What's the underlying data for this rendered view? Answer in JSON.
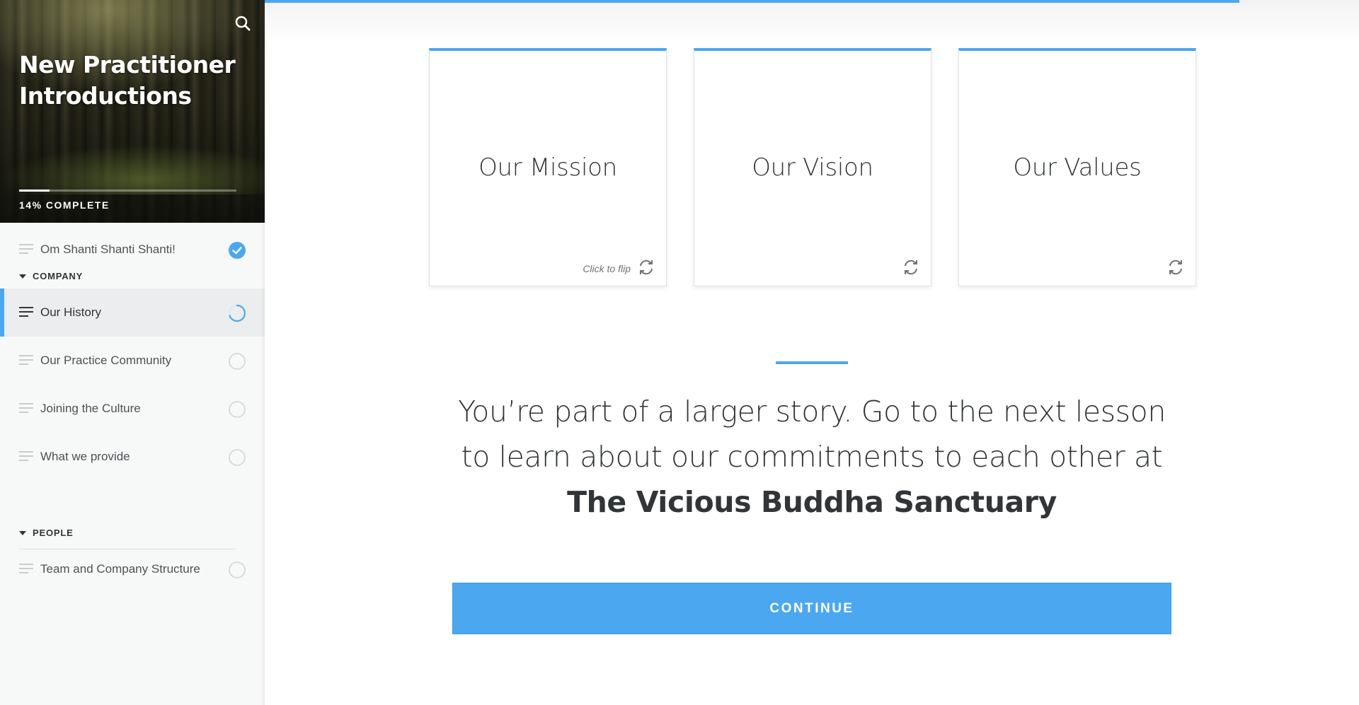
{
  "sidebar": {
    "course_title": "New Practitioner Introductions",
    "progress_percent": 14,
    "progress_label": "14% COMPLETE",
    "items": [
      {
        "type": "lesson",
        "label": "Om Shanti Shanti Shanti!",
        "status": "complete"
      },
      {
        "type": "section",
        "label": "COMPANY"
      },
      {
        "type": "lesson",
        "label": "Our History",
        "status": "in-progress",
        "active": true
      },
      {
        "type": "lesson",
        "label": "Our Practice Community",
        "status": "not-started"
      },
      {
        "type": "lesson",
        "label": "Joining the Culture",
        "status": "not-started"
      },
      {
        "type": "lesson",
        "label": "What we provide",
        "status": "not-started"
      },
      {
        "type": "section",
        "label": "PEOPLE"
      },
      {
        "type": "lesson",
        "label": "Team and Company Structure",
        "status": "not-started"
      }
    ]
  },
  "main": {
    "cards": [
      {
        "title": "Our Mission",
        "hint": "Click to flip"
      },
      {
        "title": "Our Vision",
        "hint": ""
      },
      {
        "title": "Our Values",
        "hint": ""
      }
    ],
    "story_text": "You’re part of a larger story. Go to the next lesson to learn about our commitments to each other at ",
    "story_emphasis": "The Vicious Buddha Sanctuary",
    "continue_label": "CONTINUE"
  },
  "colors": {
    "accent": "#4ba8f0",
    "text": "#313537",
    "sidebar_bg": "#f7f8f8",
    "active_row_bg": "#ecedee"
  },
  "icons": {
    "search": "search-icon",
    "check": "check-circle-icon",
    "progress": "progress-ring-icon",
    "empty": "empty-circle-icon",
    "flip": "flip-rotate-icon",
    "lesson": "lesson-lines-icon",
    "caret": "caret-down-icon"
  }
}
